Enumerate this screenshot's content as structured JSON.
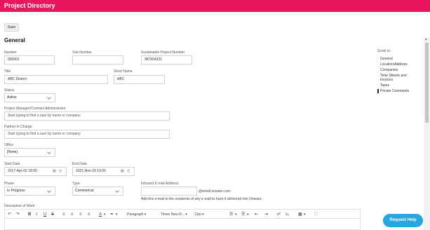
{
  "header": {
    "title": "Project Directory"
  },
  "toolbar": {
    "save_label": "Save"
  },
  "section": {
    "title": "General"
  },
  "fields": {
    "number": {
      "label": "Number",
      "value": "000001"
    },
    "sub_number": {
      "label": "Sub Number",
      "value": ""
    },
    "sustainable_number": {
      "label": "Sustainable Project Number",
      "value": "987654321"
    },
    "title": {
      "label": "Title",
      "value": "ABC District"
    },
    "short_name": {
      "label": "Short Name",
      "value": "ABC"
    },
    "status": {
      "label": "Status",
      "value": "Active"
    },
    "project_manager": {
      "label": "Project Manager/Contract Administrator",
      "placeholder": "Start typing to find a user by name or company"
    },
    "partner": {
      "label": "Partner in Charge",
      "placeholder": "Start typing to find a user by name or company"
    },
    "office": {
      "label": "Office",
      "value": "[None]"
    },
    "start_date": {
      "label": "Start Date",
      "value": "2017-Apr-02 18:00"
    },
    "end_date": {
      "label": "End Date",
      "value": "2021-Nov-29 19:00"
    },
    "phase": {
      "label": "Phase",
      "value": "In Progress"
    },
    "type": {
      "label": "Type",
      "value": "Commerical"
    },
    "inbound_email": {
      "label": "Inbound E-mail Address",
      "value": "",
      "suffix": "@email.onware.com",
      "help": "Add this e-mail to the recipients of any e-mail to have it delivered into Onware."
    },
    "description": {
      "label": "Description of Work"
    }
  },
  "editor_toolbar": {
    "paragraph": "Paragraph",
    "font": "Times New R...",
    "size": "12pt"
  },
  "scroll_to": {
    "heading": "Scroll to:",
    "items": [
      {
        "label": "General"
      },
      {
        "label": "Location/Address"
      },
      {
        "label": "Companies"
      },
      {
        "label": "Time Sheets and Invoices"
      },
      {
        "label": "Taxes"
      },
      {
        "label": "Private Comments"
      }
    ]
  },
  "help": {
    "label": "Request Help"
  }
}
